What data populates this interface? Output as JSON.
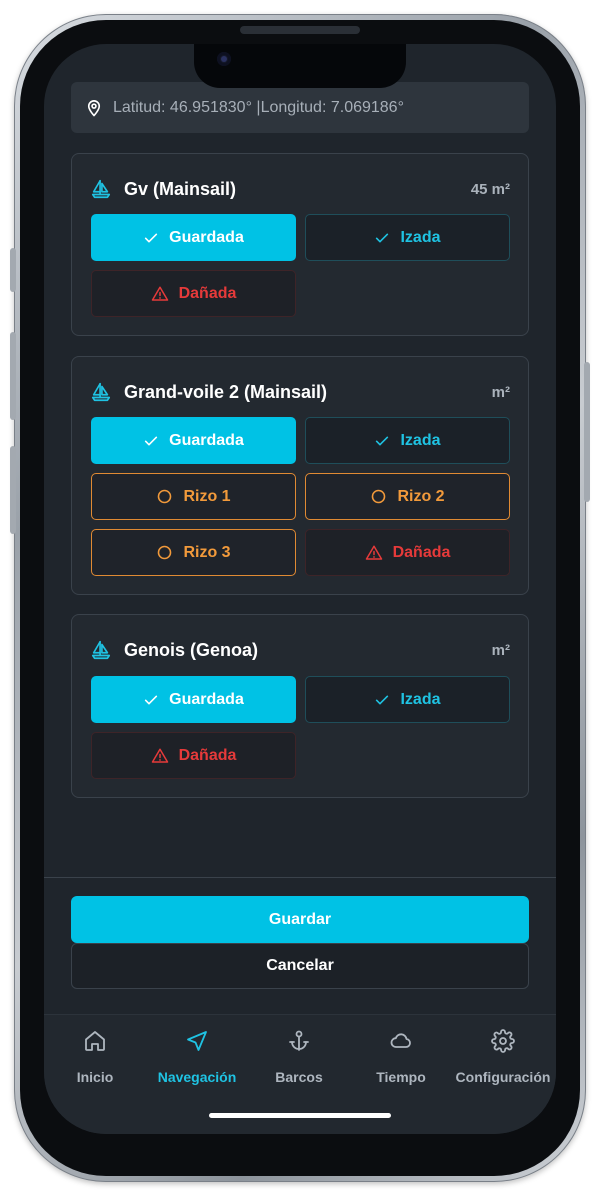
{
  "location": {
    "text": "Latitud: 46.951830° |Longitud: 7.069186°"
  },
  "sails": [
    {
      "name": "Gv (Mainsail)",
      "area": "45 m²",
      "buttons": {
        "stored": "Guardada",
        "hoisted": "Izada",
        "damaged": "Dañada"
      }
    },
    {
      "name": "Grand-voile 2 (Mainsail)",
      "area": "m²",
      "buttons": {
        "stored": "Guardada",
        "hoisted": "Izada",
        "reef1": "Rizo 1",
        "reef2": "Rizo 2",
        "reef3": "Rizo 3",
        "damaged": "Dañada"
      }
    },
    {
      "name": "Genois (Genoa)",
      "area": "m²",
      "buttons": {
        "stored": "Guardada",
        "hoisted": "Izada",
        "damaged": "Dañada"
      }
    }
  ],
  "actions": {
    "save": "Guardar",
    "cancel": "Cancelar"
  },
  "tabs": [
    {
      "label": "Inicio",
      "icon": "home-icon"
    },
    {
      "label": "Navegación",
      "icon": "navigation-icon"
    },
    {
      "label": "Barcos",
      "icon": "anchor-icon"
    },
    {
      "label": "Tiempo",
      "icon": "cloud-icon"
    },
    {
      "label": "Configuración",
      "icon": "gear-icon"
    }
  ],
  "active_tab": "Navegación",
  "colors": {
    "accent": "#00c2e5",
    "reef": "#f29a3b",
    "danger": "#e63a3a",
    "background": "#1f252c",
    "card": "#232930"
  }
}
